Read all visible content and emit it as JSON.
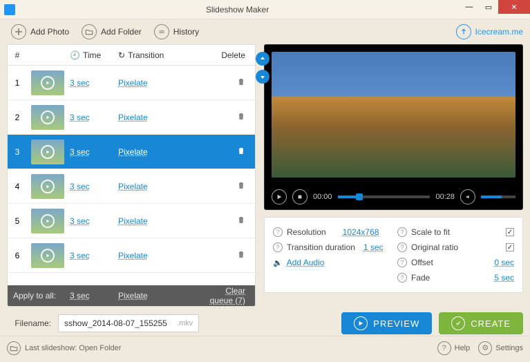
{
  "app_title": "Slideshow Maker",
  "toolbar": {
    "add_photo": "Add Photo",
    "add_folder": "Add Folder",
    "history": "History",
    "brand": "Icecream.me"
  },
  "cols": {
    "num": "#",
    "time": "Time",
    "transition": "Transition",
    "del": "Delete"
  },
  "rows": [
    {
      "n": "1",
      "time": "3 sec",
      "trans": "Pixelate"
    },
    {
      "n": "2",
      "time": "3 sec",
      "trans": "Pixelate"
    },
    {
      "n": "3",
      "time": "3 sec",
      "trans": "Pixelate"
    },
    {
      "n": "4",
      "time": "3 sec",
      "trans": "Pixelate"
    },
    {
      "n": "5",
      "time": "3 sec",
      "trans": "Pixelate"
    },
    {
      "n": "6",
      "time": "3 sec",
      "trans": "Pixelate"
    }
  ],
  "apply": {
    "label": "Apply to all:",
    "time": "3 sec",
    "trans": "Pixelate",
    "clear": "Clear queue (7)"
  },
  "player": {
    "cur": "00:00",
    "dur": "00:28"
  },
  "settings": {
    "resolution_label": "Resolution",
    "resolution_val": "1024x768",
    "tdur_label": "Transition duration",
    "tdur_val": "1 sec",
    "addaudio": "Add Audio",
    "scale_label": "Scale to fit",
    "orig_label": "Original ratio",
    "offset_label": "Offset",
    "offset_val": "0 sec",
    "fade_label": "Fade",
    "fade_val": "5 sec"
  },
  "filename": {
    "label": "Filename:",
    "value": "sshow_2014-08-07_155255",
    "ext": ".mkv"
  },
  "buttons": {
    "preview": "PREVIEW",
    "create": "CREATE"
  },
  "footer": {
    "last": "Last slideshow: Open Folder",
    "help": "Help",
    "settings": "Settings"
  }
}
